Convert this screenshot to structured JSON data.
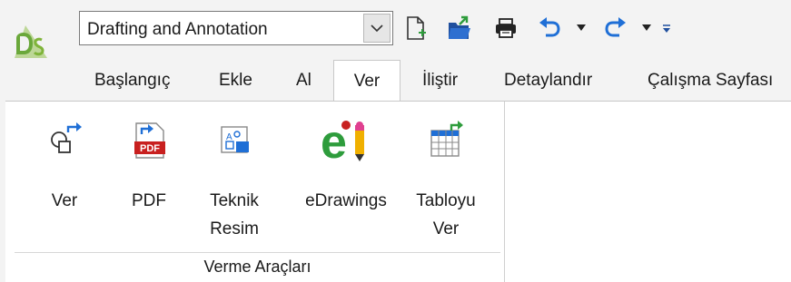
{
  "quick_access": {
    "workspace_value": "Drafting and Annotation",
    "icons": [
      "app-logo-icon",
      "new-document-icon",
      "open-document-icon",
      "print-icon",
      "undo-icon",
      "redo-icon",
      "customize-icon"
    ]
  },
  "tabs": [
    {
      "label": "Başlangıç",
      "active": false
    },
    {
      "label": "Ekle",
      "active": false
    },
    {
      "label": "Al",
      "active": false
    },
    {
      "label": "Ver",
      "active": true
    },
    {
      "label": "İliştir",
      "active": false
    },
    {
      "label": "Detaylandır",
      "active": false
    },
    {
      "label": "Çalışma Sayfası",
      "active": false
    }
  ],
  "ribbon": {
    "group_label": "Verme Araçları",
    "buttons": [
      {
        "label_line1": "Ver",
        "label_line2": "",
        "icon": "export-shape-icon"
      },
      {
        "label_line1": "PDF",
        "label_line2": "",
        "icon": "pdf-icon"
      },
      {
        "label_line1": "Teknik",
        "label_line2": "Resim",
        "icon": "technical-drawing-icon"
      },
      {
        "label_line1": "eDrawings",
        "label_line2": "",
        "icon": "edrawings-icon"
      },
      {
        "label_line1": "Tabloyu",
        "label_line2": "Ver",
        "icon": "export-table-icon"
      }
    ]
  },
  "colors": {
    "accent_blue": "#1f6fd6",
    "pdf_red": "#c8201f",
    "edrawings_green": "#2e9c3c",
    "logo_green": "#7fb43a"
  }
}
